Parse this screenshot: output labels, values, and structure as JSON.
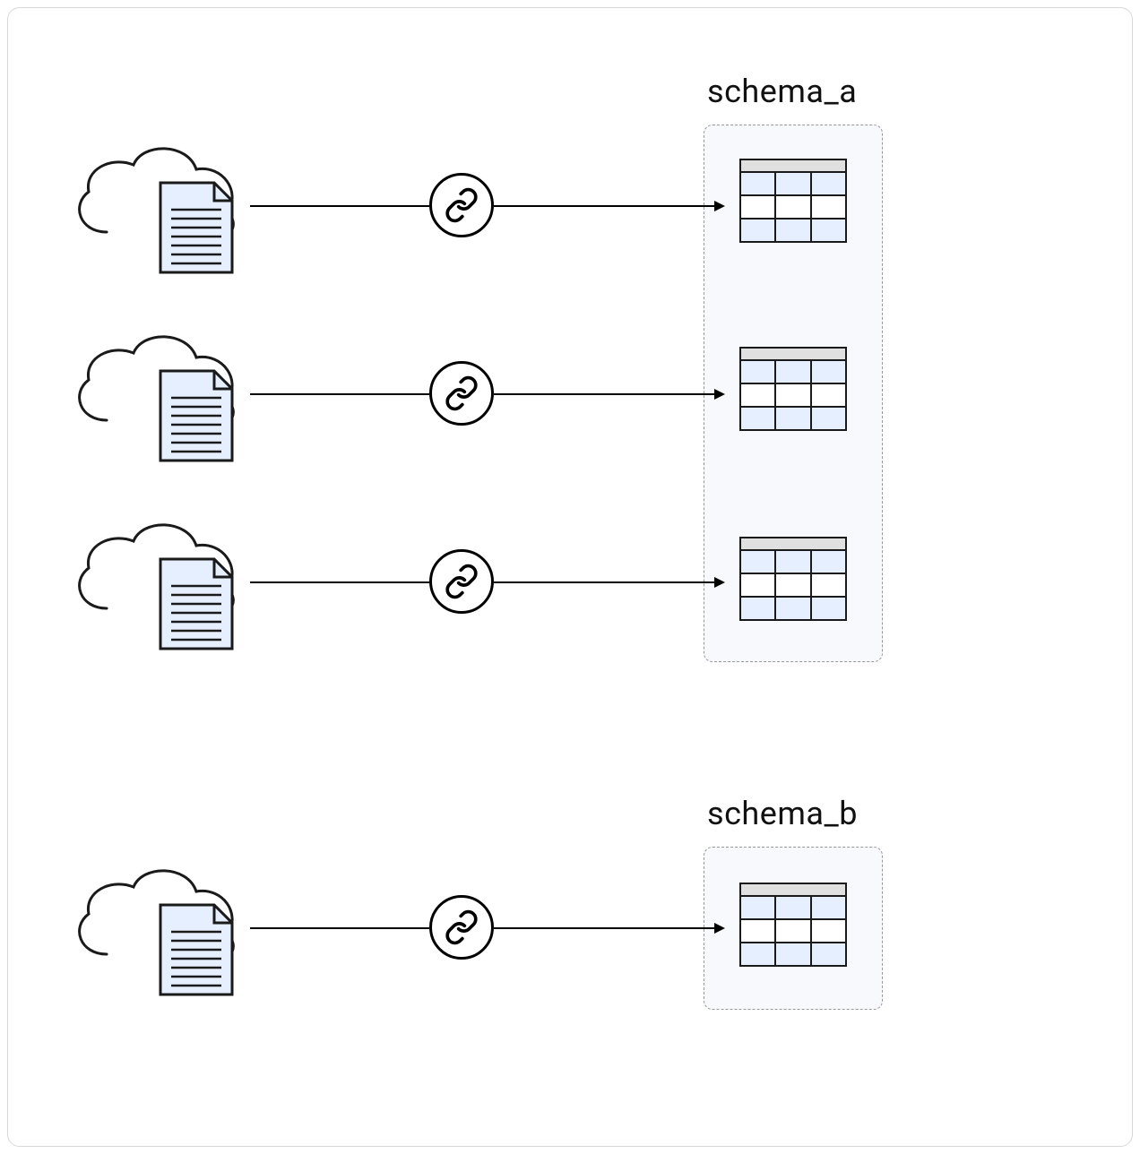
{
  "schemas": {
    "a": {
      "label": "schema_a"
    },
    "b": {
      "label": "schema_b"
    }
  },
  "flows": [
    {
      "from": "cloud-source-1",
      "via": "link-1",
      "to": "table-1",
      "schema": "a"
    },
    {
      "from": "cloud-source-2",
      "via": "link-2",
      "to": "table-2",
      "schema": "a"
    },
    {
      "from": "cloud-source-3",
      "via": "link-3",
      "to": "table-3",
      "schema": "a"
    },
    {
      "from": "cloud-source-4",
      "via": "link-4",
      "to": "table-4",
      "schema": "b"
    }
  ],
  "colors": {
    "stroke": "#000000",
    "tableFill": "#e5efff",
    "tableHeader": "#e0e0e0",
    "docFill": "#e5efff",
    "schemaBg": "#f8f9fc"
  }
}
